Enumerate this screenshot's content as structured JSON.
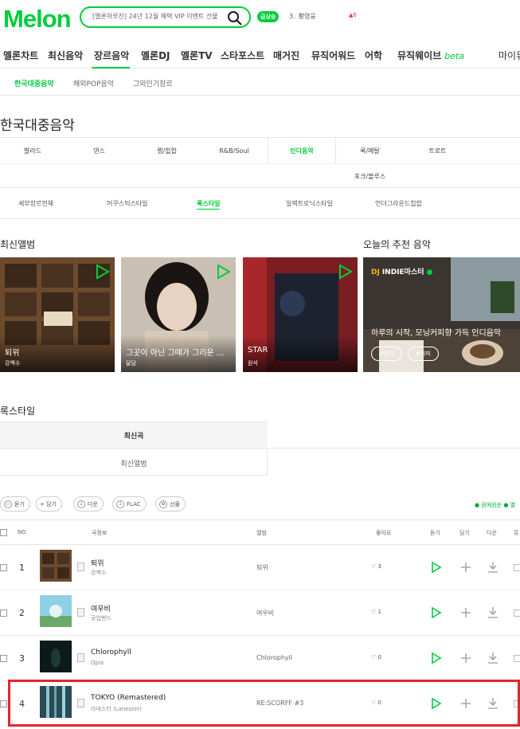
{
  "header": {
    "logo": "Mel",
    "logo_tail": "n",
    "search_text": "[멜론하루진] 24년 12월 혜택 VIP 이벤트 선물",
    "rank_badge": "급상승",
    "rank_number": "3.",
    "rank_word": "황영웅",
    "rank_change": "▲6"
  },
  "gnb": {
    "items": [
      "멜론차트",
      "최신음악",
      "장르음악",
      "멜론DJ",
      "멜론TV",
      "스타포스트",
      "매거진",
      "뮤직어워드",
      "어학",
      "뮤직웨이브",
      "마이뮤직"
    ],
    "beta": "beta"
  },
  "sub_tabs": [
    "한국대중음악",
    "해외POP음악",
    "그외인기장르"
  ],
  "page_title": "한국대중음악",
  "genres": [
    "발라드",
    "댄스",
    "랩/힙합",
    "R&B/Soul",
    "인디음악",
    "록/메탈",
    "트로트",
    "포크/블루스"
  ],
  "detail_tabs": [
    "세부장르전체",
    "어쿠스틱스타일",
    "록스타일",
    "일렉트로닉스타일",
    "언더그라운드힙합"
  ],
  "latest_albums_title": "최신앨범",
  "albums": [
    {
      "title": "퇴위",
      "artist": "강백수"
    },
    {
      "title": "그곳이 아닌 그때가 그리운 ...",
      "artist": "달담"
    },
    {
      "title": "STAR",
      "artist": "원석"
    }
  ],
  "recommend": {
    "title": "오늘의 추천 음악",
    "dj": "DJ",
    "dj_name": "INDIE마스터",
    "headline": "하루의 시작, 모닝커피향 가득 인디음악",
    "tags": [
      "#인디",
      "#커피"
    ]
  },
  "rock_section": {
    "title": "록스타일",
    "tabs": [
      "최신곡",
      "최신앨범"
    ]
  },
  "actions": {
    "buttons": [
      "듣기",
      "+ 담기",
      "다운",
      "FLAC",
      "선물"
    ],
    "legend": "● 원에원순 ● 앨"
  },
  "table": {
    "headers": [
      "NO",
      "곡정보",
      "앨범",
      "좋아요",
      "듣기",
      "담기",
      "다운",
      "뮤"
    ],
    "rows": [
      {
        "no": "1",
        "song": "퇴위",
        "artist": "강백수",
        "album": "퇴위",
        "likes": "3"
      },
      {
        "no": "2",
        "song": "여우비",
        "artist": "공업밴드",
        "album": "여우비",
        "likes": "1"
      },
      {
        "no": "3",
        "song": "Chlorophyll",
        "artist": "Opia",
        "album": "Chlorophyll",
        "likes": "0"
      },
      {
        "no": "4",
        "song": "TOKYO (Remastered)",
        "artist": "라네스터 (Lanester)",
        "album": "RE:SCORFF #3",
        "likes": "0"
      }
    ]
  },
  "colors": {
    "brand": "#00cd3c",
    "highlight": "#e0262c"
  }
}
